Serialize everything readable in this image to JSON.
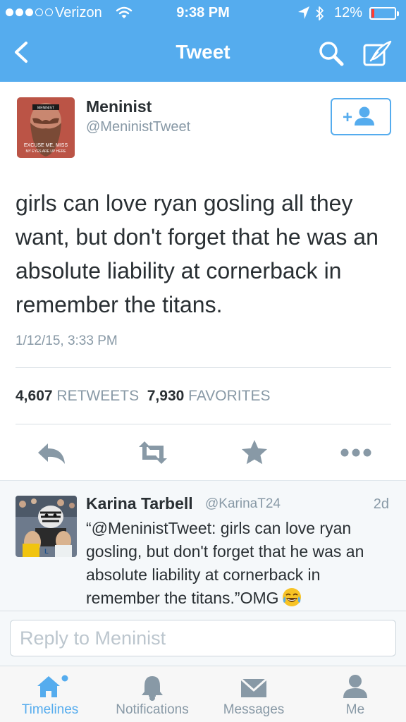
{
  "status_bar": {
    "carrier": "Verizon",
    "time": "9:38 PM",
    "battery": "12%",
    "battery_level": 0.12,
    "signal_dots_filled": 3,
    "signal_dots_total": 5
  },
  "nav": {
    "title": "Tweet",
    "back_icon": "chevron-left-icon",
    "search_icon": "search-icon",
    "compose_icon": "compose-icon"
  },
  "tweet": {
    "author_name": "Meninist",
    "author_handle": "@MeninistTweet",
    "avatar_caption": [
      "MENINIST",
      "EXCUSE ME, MISS",
      "MY EYES ARE UP HERE"
    ],
    "text": "girls can love ryan gosling all they want, but don't forget that he was an absolute liability at cornerback in remember the titans.",
    "timestamp": "1/12/15, 3:33 PM",
    "retweet_count": "4,607",
    "retweets_label": "RETWEETS",
    "favorite_count": "7,930",
    "favorites_label": "FAVORITES"
  },
  "actions": [
    "reply-icon",
    "retweet-icon",
    "favorite-icon",
    "more-icon"
  ],
  "reply": {
    "author_name": "Karina Tarbell",
    "author_handle": "@KarinaT24",
    "time": "2d",
    "text": "“@MeninistTweet: girls can love ryan gosling, but don't forget that he was an absolute liability at cornerback in remember the titans.”OMG",
    "emoji": "tears-of-joy-icon"
  },
  "compose": {
    "placeholder": "Reply to Meninist",
    "value": ""
  },
  "tabs": [
    {
      "label": "Timelines",
      "icon": "home-icon",
      "active": true
    },
    {
      "label": "Notifications",
      "icon": "bell-icon",
      "active": false
    },
    {
      "label": "Messages",
      "icon": "envelope-icon",
      "active": false
    },
    {
      "label": "Me",
      "icon": "person-icon",
      "active": false
    }
  ],
  "colors": {
    "brand": "#55acee",
    "text": "#292f33",
    "muted": "#8899a6",
    "icon": "#8899a6",
    "battery_low": "#ff3b30"
  }
}
